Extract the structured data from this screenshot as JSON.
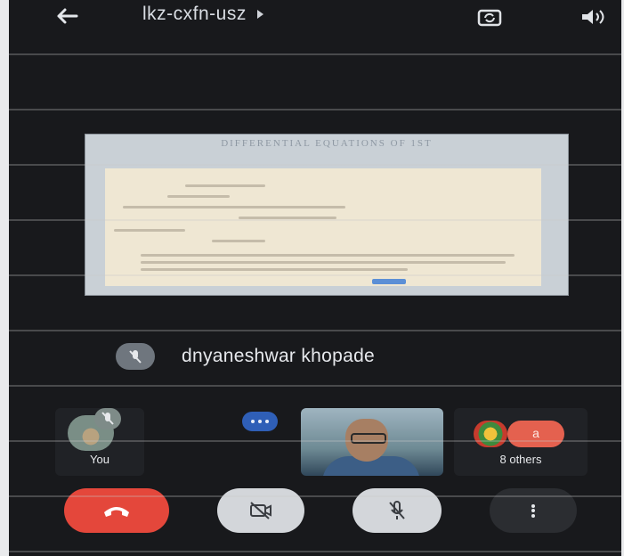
{
  "header": {
    "meeting_code": "lkz-cxfn-usz",
    "back_icon": "arrow-left-icon",
    "switch_camera_icon": "camera-switch-icon",
    "speaker_icon": "speaker-icon"
  },
  "presentation": {
    "document_title": "DIFFERENTIAL EQUATIONS OF 1ST"
  },
  "presenter": {
    "name": "dnyaneshwar khopade",
    "mic_icon": "mic-off-icon"
  },
  "participants": {
    "self_label": "You",
    "others_label": "8 others",
    "others_avatar_letter": "a"
  },
  "controls": {
    "end_call_icon": "phone-hangup-icon",
    "camera_icon": "camera-off-icon",
    "mic_icon": "mic-off-icon",
    "more_icon": "more-vert-icon"
  },
  "colors": {
    "background": "#18191c",
    "end_call": "#e4473b",
    "control_light": "#d3d6da",
    "accent_blue": "#2f5fb7"
  }
}
